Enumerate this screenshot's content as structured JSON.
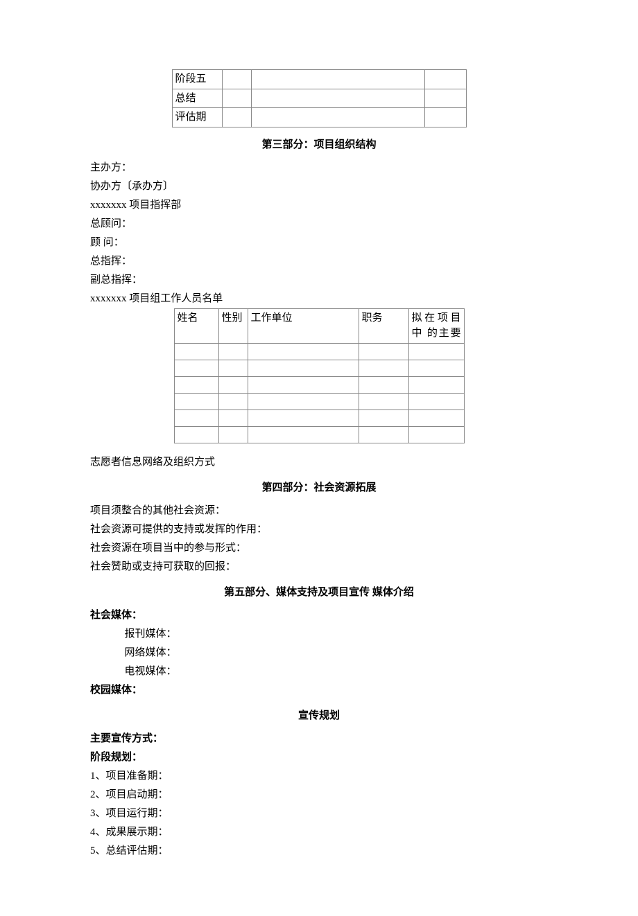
{
  "table1": {
    "rows": [
      [
        "阶段五",
        "",
        "",
        ""
      ],
      [
        "总结",
        "",
        "",
        ""
      ],
      [
        "评估期",
        "",
        "",
        ""
      ]
    ]
  },
  "section3": {
    "heading": "第三部分：项目组织结构",
    "lines": [
      "主办方：",
      "协办方〔承办方〕",
      "xxxxxxx 项目指挥部",
      "总顾问：",
      "顾  问：",
      "总指挥：",
      "副总指挥：",
      "xxxxxxx 项目组工作人员名单"
    ]
  },
  "table2": {
    "headers": [
      "姓名",
      "性别",
      "工作单位",
      "职务",
      "拟在项目中 的主要"
    ],
    "empty_rows": 6
  },
  "volunteer_line": "志愿者信息网络及组织方式",
  "section4": {
    "heading": "第四部分：社会资源拓展",
    "lines": [
      "项目须整合的其他社会资源：",
      "社会资源可提供的支持或发挥的作用：",
      "社会资源在项目当中的参与形式：",
      "社会赞助或支持可获取的回报："
    ]
  },
  "section5": {
    "heading": "第五部分、媒体支持及项目宣传  媒体介绍",
    "social_media": "社会媒体：",
    "media_types": [
      "报刊媒体：",
      "网络媒体：",
      "电视媒体："
    ],
    "campus_media": "校园媒体：",
    "sub_heading": "宣传规划",
    "main_method": "主要宣传方式：",
    "phase_plan": "阶段规划：",
    "phases": [
      "1、项目准备期：",
      "2、项目启动期：",
      "3、项目运行期：",
      "4、成果展示期：",
      "5、总结评估期："
    ]
  }
}
